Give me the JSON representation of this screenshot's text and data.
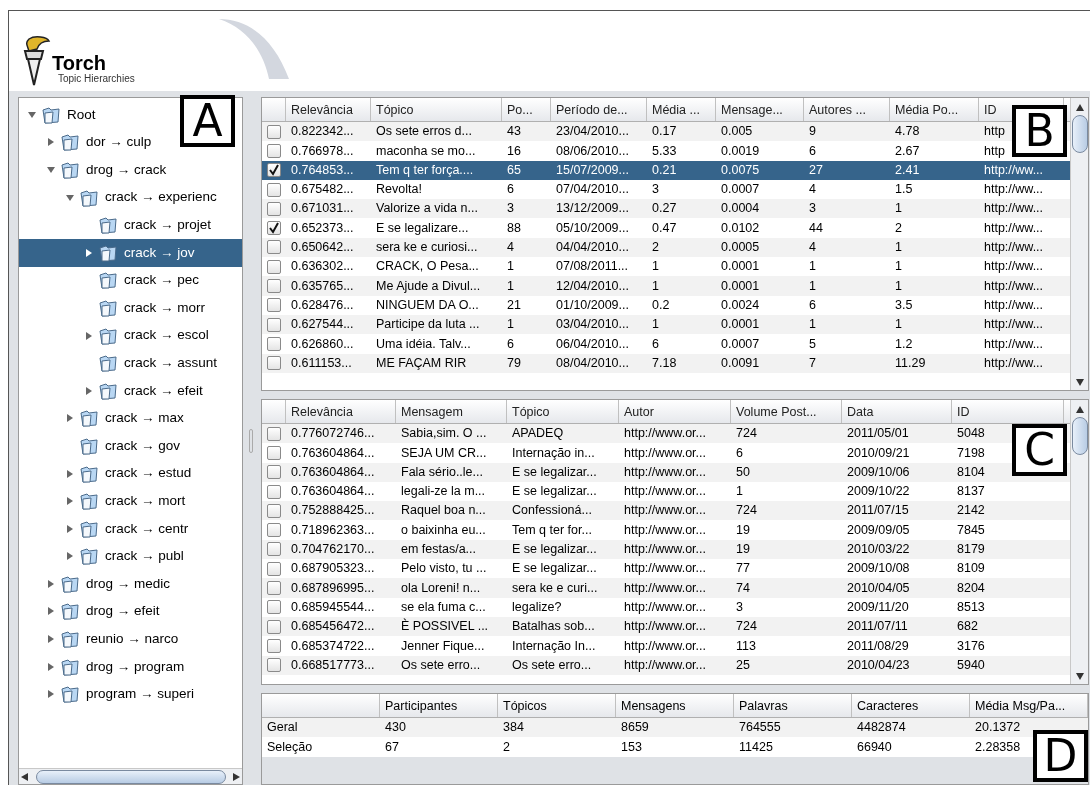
{
  "header": {
    "title": "Torch",
    "subtitle": "Topic Hierarchies"
  },
  "tree": {
    "label": "Root",
    "expanded": true,
    "selected": false,
    "children": [
      {
        "label": "dor → culp",
        "expanded": false,
        "selected": false
      },
      {
        "label": "drog → crack",
        "expanded": true,
        "selected": false,
        "children": [
          {
            "label": "crack → experienc",
            "expanded": true,
            "selected": false,
            "children": [
              {
                "label": "crack → projet",
                "selected": false
              },
              {
                "label": "crack → jov",
                "expanded": false,
                "selected": true
              },
              {
                "label": "crack → pec",
                "selected": false
              },
              {
                "label": "crack → morr",
                "selected": false
              },
              {
                "label": "crack → escol",
                "expanded": false,
                "selected": false
              },
              {
                "label": "crack → assunt",
                "selected": false
              },
              {
                "label": "crack → efeit",
                "expanded": false,
                "selected": false
              }
            ]
          },
          {
            "label": "crack → max",
            "expanded": false,
            "selected": false
          },
          {
            "label": "crack → gov",
            "selected": false
          },
          {
            "label": "crack → estud",
            "expanded": false,
            "selected": false
          },
          {
            "label": "crack → mort",
            "expanded": false,
            "selected": false
          },
          {
            "label": "crack → centr",
            "expanded": false,
            "selected": false
          },
          {
            "label": "crack → publ",
            "expanded": false,
            "selected": false
          }
        ]
      },
      {
        "label": "drog → medic",
        "expanded": false,
        "selected": false
      },
      {
        "label": "drog → efeit",
        "expanded": false,
        "selected": false
      },
      {
        "label": "reunio → narco",
        "expanded": false,
        "selected": false
      },
      {
        "label": "drog → program",
        "expanded": false,
        "selected": false
      },
      {
        "label": "program → superi",
        "expanded": false,
        "selected": false
      }
    ]
  },
  "topics_table": {
    "columns": [
      "Relevância",
      "Tópico",
      "Po...",
      "Período de...",
      "Média ...",
      "Mensage...",
      "Autores ...",
      "Média Po...",
      "ID"
    ],
    "rows": [
      {
        "checked": false,
        "selected": false,
        "cells": [
          "0.822342...",
          "Os sete erros d...",
          "43",
          "23/04/2010...",
          "0.17",
          "0.005",
          "9",
          "4.78",
          "http"
        ]
      },
      {
        "checked": false,
        "selected": false,
        "cells": [
          "0.766978...",
          "maconha se mo...",
          "16",
          "08/06/2010...",
          "5.33",
          "0.0019",
          "6",
          "2.67",
          "http"
        ]
      },
      {
        "checked": true,
        "selected": true,
        "cells": [
          "0.764853...",
          "Tem q ter força....",
          "65",
          "15/07/2009...",
          "0.21",
          "0.0075",
          "27",
          "2.41",
          "http://ww..."
        ]
      },
      {
        "checked": false,
        "selected": false,
        "cells": [
          "0.675482...",
          "Revolta!",
          "6",
          "07/04/2010...",
          "3",
          "0.0007",
          "4",
          "1.5",
          "http://ww..."
        ]
      },
      {
        "checked": false,
        "selected": false,
        "cells": [
          "0.671031...",
          "Valorize a vida n...",
          "3",
          "13/12/2009...",
          "0.27",
          "0.0004",
          "3",
          "1",
          "http://ww..."
        ]
      },
      {
        "checked": true,
        "selected": false,
        "cells": [
          "0.652373...",
          "E se legalizare...",
          "88",
          "05/10/2009...",
          "0.47",
          "0.0102",
          "44",
          "2",
          "http://ww..."
        ]
      },
      {
        "checked": false,
        "selected": false,
        "cells": [
          "0.650642...",
          "sera ke e curiosi...",
          "4",
          "04/04/2010...",
          "2",
          "0.0005",
          "4",
          "1",
          "http://ww..."
        ]
      },
      {
        "checked": false,
        "selected": false,
        "cells": [
          "0.636302...",
          "CRACK, O Pesa...",
          "1",
          "07/08/2011...",
          "1",
          "0.0001",
          "1",
          "1",
          "http://ww..."
        ]
      },
      {
        "checked": false,
        "selected": false,
        "cells": [
          "0.635765...",
          "Me Ajude a Divul...",
          "1",
          "12/04/2010...",
          "1",
          "0.0001",
          "1",
          "1",
          "http://ww..."
        ]
      },
      {
        "checked": false,
        "selected": false,
        "cells": [
          "0.628476...",
          "NINGUEM DA O...",
          "21",
          "01/10/2009...",
          "0.2",
          "0.0024",
          "6",
          "3.5",
          "http://ww..."
        ]
      },
      {
        "checked": false,
        "selected": false,
        "cells": [
          "0.627544...",
          "Participe da luta ...",
          "1",
          "03/04/2010...",
          "1",
          "0.0001",
          "1",
          "1",
          "http://ww..."
        ]
      },
      {
        "checked": false,
        "selected": false,
        "cells": [
          "0.626860...",
          "Uma idéia. Talv...",
          "6",
          "06/04/2010...",
          "6",
          "0.0007",
          "5",
          "1.2",
          "http://ww..."
        ]
      },
      {
        "checked": false,
        "selected": false,
        "cells": [
          "0.611153...",
          "ME FAÇAM RIR",
          "79",
          "08/04/2010...",
          "7.18",
          "0.0091",
          "7",
          "11.29",
          "http://ww..."
        ]
      }
    ]
  },
  "messages_table": {
    "columns": [
      "Relevância",
      "Mensagem",
      "Tópico",
      "Autor",
      "Volume Post...",
      "Data",
      "ID"
    ],
    "rows": [
      {
        "checked": false,
        "selected": false,
        "cells": [
          "0.776072746...",
          "Sabia,sim. O ...",
          "APADEQ",
          "http://www.or...",
          "724",
          "2011/05/01",
          "5048"
        ]
      },
      {
        "checked": false,
        "selected": false,
        "cells": [
          "0.763604864...",
          "SEJA UM CR...",
          "Internação in...",
          "http://www.or...",
          "6",
          "2010/09/21",
          "7198"
        ]
      },
      {
        "checked": false,
        "selected": false,
        "cells": [
          "0.763604864...",
          "Fala sério..le...",
          "E se legalizar...",
          "http://www.or...",
          "50",
          "2009/10/06",
          "8104"
        ]
      },
      {
        "checked": false,
        "selected": false,
        "cells": [
          "0.763604864...",
          "legali-ze la m...",
          "E se legalizar...",
          "http://www.or...",
          "1",
          "2009/10/22",
          "8137"
        ]
      },
      {
        "checked": false,
        "selected": false,
        "cells": [
          "0.752888425...",
          "Raquel boa n...",
          "Confessioná...",
          "http://www.or...",
          "724",
          "2011/07/15",
          "2142"
        ]
      },
      {
        "checked": false,
        "selected": false,
        "cells": [
          "0.718962363...",
          "o baixinha eu...",
          "Tem q ter for...",
          "http://www.or...",
          "19",
          "2009/09/05",
          "7845"
        ]
      },
      {
        "checked": false,
        "selected": false,
        "cells": [
          "0.704762170...",
          "em festas/a...",
          "E se legalizar...",
          "http://www.or...",
          "19",
          "2010/03/22",
          "8179"
        ]
      },
      {
        "checked": false,
        "selected": false,
        "cells": [
          "0.687905323...",
          "Pelo visto, tu ...",
          "E se legalizar...",
          "http://www.or...",
          "77",
          "2009/10/08",
          "8109"
        ]
      },
      {
        "checked": false,
        "selected": false,
        "cells": [
          "0.687896995...",
          "ola Loreni! n...",
          "sera ke e curi...",
          "http://www.or...",
          "74",
          "2010/04/05",
          "8204"
        ]
      },
      {
        "checked": false,
        "selected": false,
        "cells": [
          "0.685945544...",
          "se ela fuma c...",
          "legalize?",
          "http://www.or...",
          "3",
          "2009/11/20",
          "8513"
        ]
      },
      {
        "checked": false,
        "selected": false,
        "cells": [
          "0.685456472...",
          "È POSSIVEL ...",
          "Batalhas sob...",
          "http://www.or...",
          "724",
          "2011/07/11",
          "682"
        ]
      },
      {
        "checked": false,
        "selected": false,
        "cells": [
          "0.685374722...",
          "Jenner Fique...",
          "Internação In...",
          "http://www.or...",
          "113",
          "2011/08/29",
          "3176"
        ]
      },
      {
        "checked": false,
        "selected": false,
        "cells": [
          "0.668517773...",
          "Os sete erro...",
          "Os sete erro...",
          "http://www.or...",
          "25",
          "2010/04/23",
          "5940"
        ]
      }
    ]
  },
  "summary_table": {
    "columns": [
      "Participantes",
      "Tópicos",
      "Mensagens",
      "Palavras",
      "Caracteres",
      "Média Msg/Pa..."
    ],
    "rows": [
      {
        "label": "Geral",
        "cells": [
          "430",
          "384",
          "8659",
          "764555",
          "4482874",
          "20.1372"
        ]
      },
      {
        "label": "Seleção",
        "cells": [
          "67",
          "2",
          "153",
          "11425",
          "66940",
          "2.28358"
        ]
      }
    ]
  },
  "annotations": [
    "A",
    "B",
    "C",
    "D"
  ]
}
